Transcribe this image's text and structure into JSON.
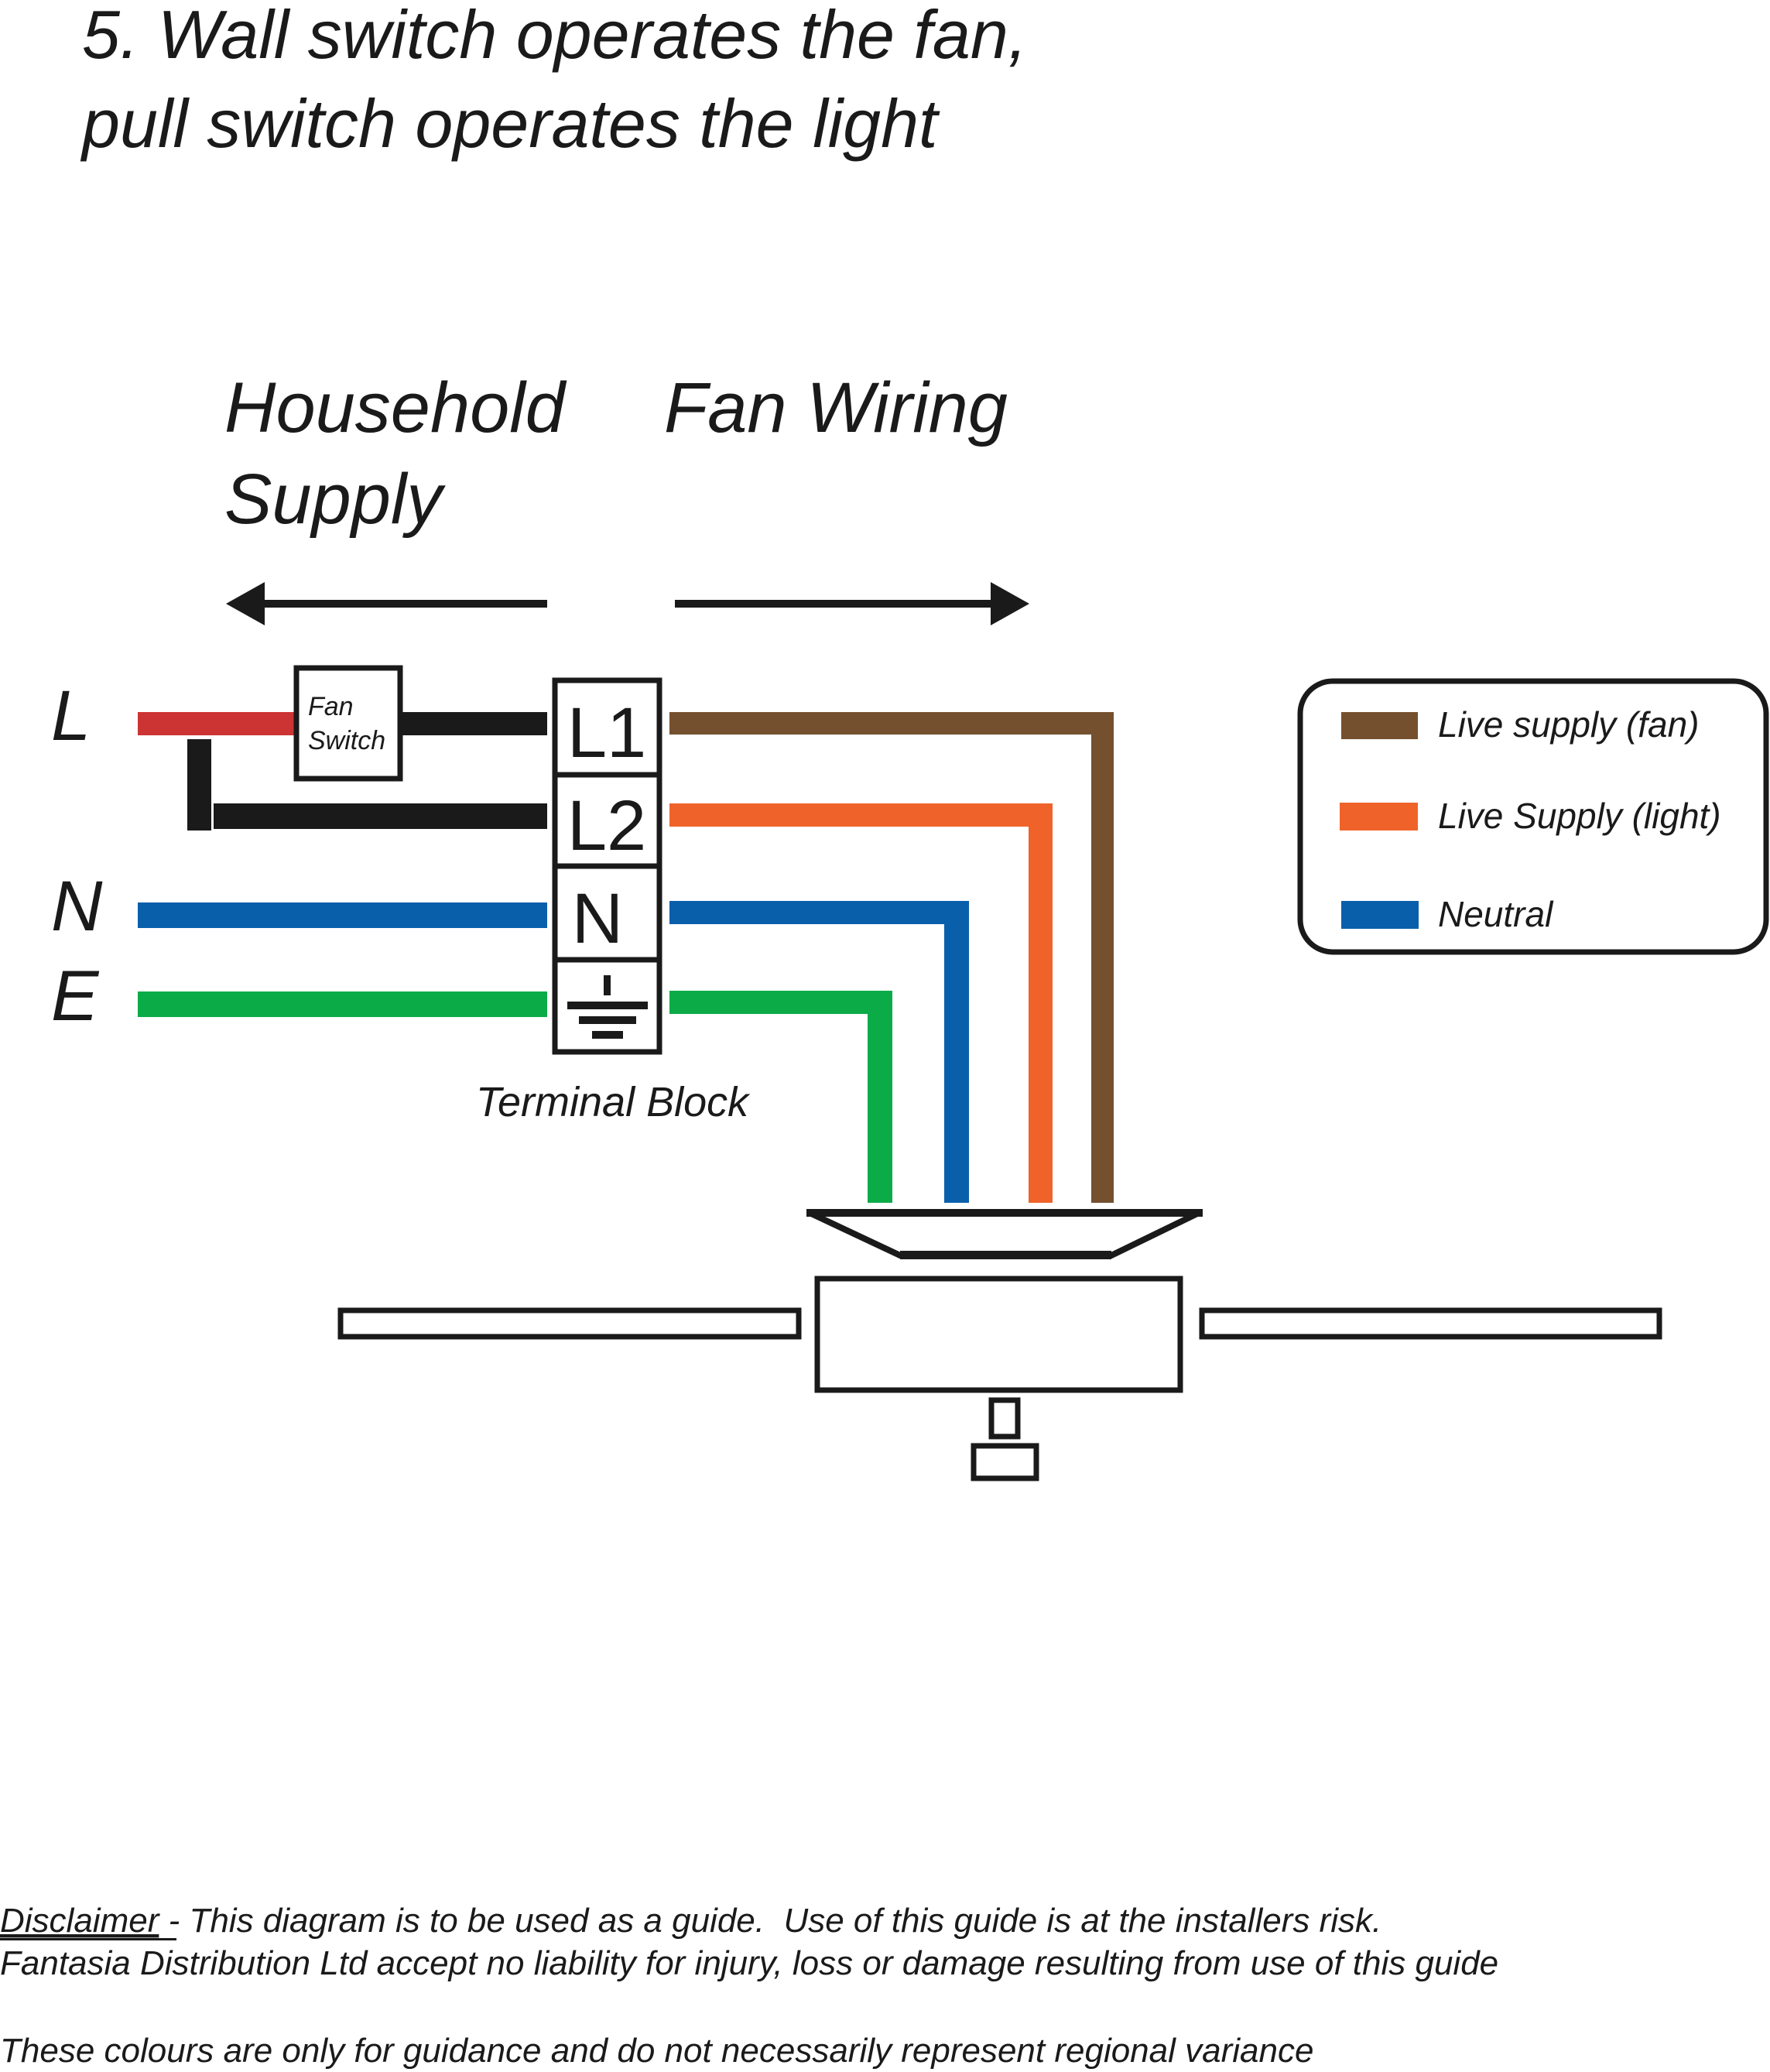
{
  "title": {
    "line1": "5. Wall switch operates the fan,",
    "line2": "pull switch operates the light"
  },
  "headings": {
    "household_line1": "Household",
    "household_line2": "Supply",
    "fan_wiring": "Fan Wiring"
  },
  "supply_labels": {
    "live": "L",
    "neutral": "N",
    "earth": "E"
  },
  "fan_switch": {
    "line1": "Fan",
    "line2": "Switch"
  },
  "terminal_block": {
    "label": "Terminal Block",
    "terminals": [
      "L1",
      "L2",
      "N",
      "earth-symbol"
    ]
  },
  "legend": {
    "items": [
      {
        "label": "Live supply (fan)",
        "color": "#75502f"
      },
      {
        "label": "Live Supply (light)",
        "color": "#ef632a"
      },
      {
        "label": "Neutral",
        "color": "#0a5fab"
      }
    ]
  },
  "wire_colors": {
    "live_supply": "#cc3333",
    "switched": "#1a1a1a",
    "live_fan": "#75502f",
    "live_light": "#ef632a",
    "neutral": "#0a5fab",
    "earth": "#0bab48"
  },
  "disclaimer": {
    "heading": "Disclaimer",
    "line1_rest": " - This diagram is to be used as a guide.  Use of this guide is at the installers risk.",
    "line2": "Fantasia Distribution Ltd accept no liability for injury, loss or damage resulting from use of this guide",
    "note": "These colours are only for guidance and do not necessarily represent regional variance"
  }
}
